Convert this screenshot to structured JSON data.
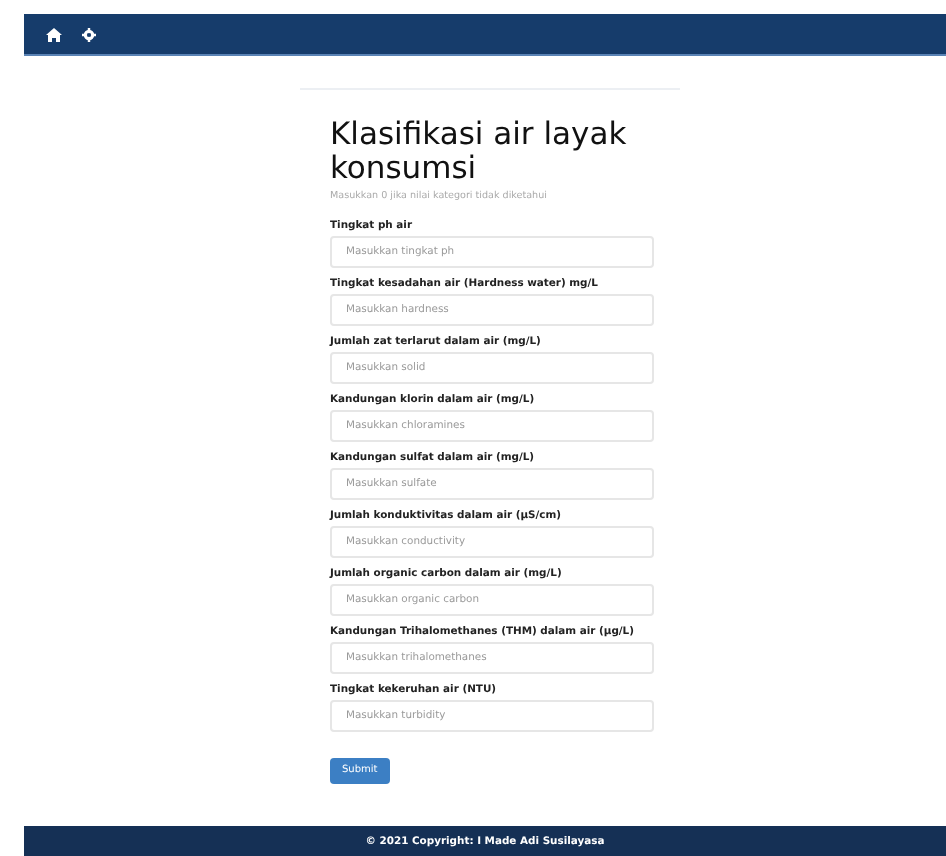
{
  "form": {
    "title": "Klasifikasi air layak konsumsi",
    "subtitle": "Masukkan 0 jika nilai kategori tidak diketahui",
    "fields": [
      {
        "label": "Tingkat ph air",
        "placeholder": "Masukkan tingkat ph"
      },
      {
        "label": "Tingkat kesadahan air (Hardness water) mg/L",
        "placeholder": "Masukkan hardness"
      },
      {
        "label": "Jumlah zat terlarut dalam air (mg/L)",
        "placeholder": "Masukkan solid"
      },
      {
        "label": "Kandungan klorin dalam air (mg/L)",
        "placeholder": "Masukkan chloramines"
      },
      {
        "label": "Kandungan sulfat dalam air (mg/L)",
        "placeholder": "Masukkan sulfate"
      },
      {
        "label": "Jumlah konduktivitas dalam air (μS/cm)",
        "placeholder": "Masukkan conductivity"
      },
      {
        "label": "Jumlah organic carbon dalam air (mg/L)",
        "placeholder": "Masukkan organic carbon"
      },
      {
        "label": "Kandungan Trihalomethanes (THM) dalam air (μg/L)",
        "placeholder": "Masukkan trihalomethanes"
      },
      {
        "label": "Tingkat kekeruhan air (NTU)",
        "placeholder": "Masukkan turbidity"
      }
    ],
    "submit": "Submit"
  },
  "footer": {
    "text": "© 2021 Copyright: I Made Adi Susilayasa"
  }
}
